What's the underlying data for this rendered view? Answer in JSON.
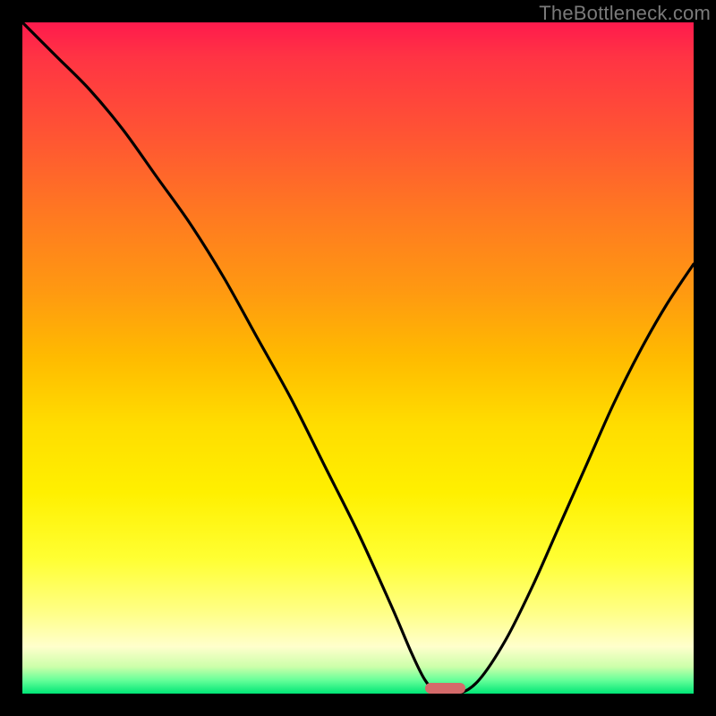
{
  "watermark": "TheBottleneck.com",
  "colors": {
    "page_bg": "#000000",
    "curve": "#000000",
    "marker": "#d46a6a",
    "gradient_top": "#ff1a4d",
    "gradient_bottom": "#00e676"
  },
  "chart_data": {
    "type": "line",
    "title": "",
    "xlabel": "",
    "ylabel": "",
    "xlim": [
      0,
      100
    ],
    "ylim": [
      0,
      100
    ],
    "grid": false,
    "series": [
      {
        "name": "bottleneck-curve",
        "x": [
          0,
          5,
          10,
          15,
          20,
          25,
          30,
          35,
          40,
          45,
          50,
          55,
          58,
          60,
          62,
          65,
          68,
          72,
          76,
          80,
          84,
          88,
          92,
          96,
          100
        ],
        "y": [
          100,
          95,
          90,
          84,
          77,
          70,
          62,
          53,
          44,
          34,
          24,
          13,
          6,
          2,
          0,
          0,
          2,
          8,
          16,
          25,
          34,
          43,
          51,
          58,
          64
        ]
      }
    ],
    "marker": {
      "name": "optimal-range",
      "x_start": 60,
      "x_end": 66,
      "y": 0
    }
  }
}
